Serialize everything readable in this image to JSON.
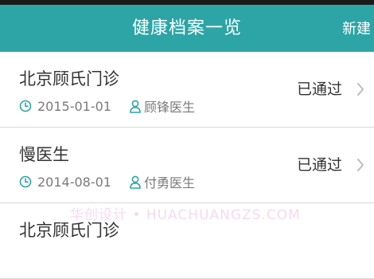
{
  "header": {
    "title": "健康档案一览",
    "action_label": "新建"
  },
  "records": [
    {
      "hospital": "北京顾氏门诊",
      "date": "2015-01-01",
      "doctor": "顾锋医生",
      "status": "已通过"
    },
    {
      "hospital": "慢医生",
      "date": "2014-08-01",
      "doctor": "付勇医生",
      "status": "已通过"
    },
    {
      "hospital": "北京顾氏门诊"
    }
  ],
  "watermark": "华创设计 • HUACHUANGZS.COM",
  "colors": {
    "header_bg": "#2da4a6",
    "accent_icon": "#2da4a6"
  },
  "icons": {
    "date": "clock-icon",
    "doctor": "person-icon",
    "row_action": "chevron-right-icon"
  }
}
